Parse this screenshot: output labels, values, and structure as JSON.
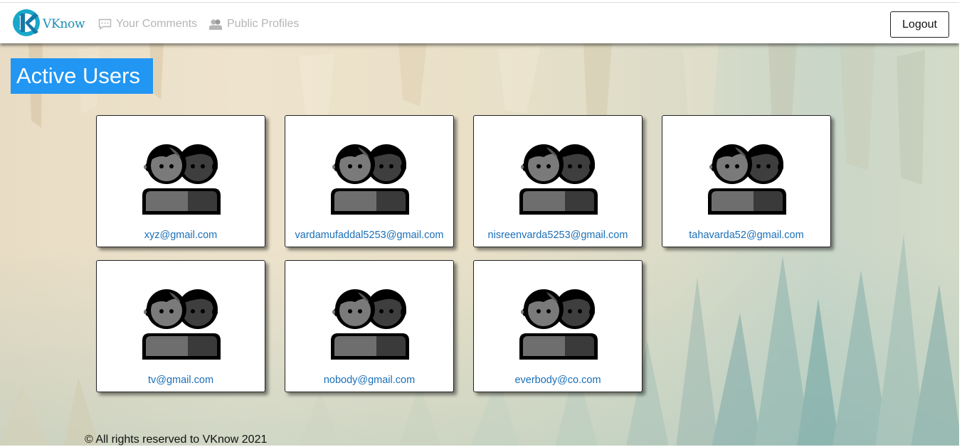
{
  "brand": {
    "name": "VKnow",
    "accent": "#1a8fb5"
  },
  "nav": {
    "comments": {
      "label": "Your Comments",
      "icon": "comment-icon"
    },
    "profiles": {
      "label": "Public Profiles",
      "icon": "users-icon"
    },
    "logout_label": "Logout"
  },
  "page": {
    "title": "Active Users",
    "title_bg": "#2196f3"
  },
  "users": [
    {
      "email": "xyz@gmail.com",
      "icon": "people-avatar-icon"
    },
    {
      "email": "vardamufaddal5253@gmail.com",
      "icon": "people-avatar-icon"
    },
    {
      "email": "nisreenvarda5253@gmail.com",
      "icon": "people-avatar-icon"
    },
    {
      "email": "tahavarda52@gmail.com",
      "icon": "people-avatar-icon"
    },
    {
      "email": "tv@gmail.com",
      "icon": "people-avatar-icon"
    },
    {
      "email": "nobody@gmail.com",
      "icon": "people-avatar-icon"
    },
    {
      "email": "everbody@co.com",
      "icon": "people-avatar-icon"
    }
  ],
  "footer": {
    "text": "© All rights reserved to VKnow 2021"
  },
  "colors": {
    "link": "#1a6fb8",
    "nav_text": "#b5b5b5"
  }
}
